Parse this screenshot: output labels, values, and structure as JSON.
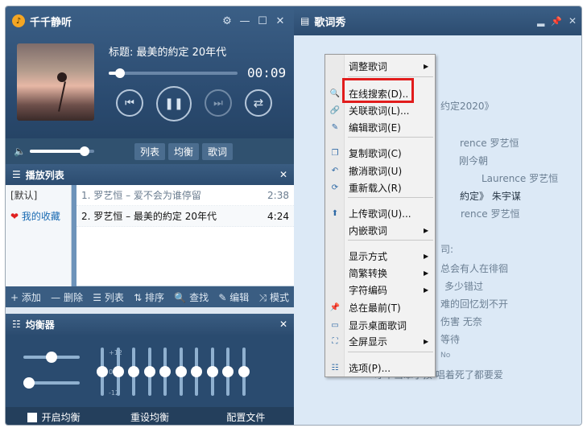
{
  "app": {
    "title": "千千静听",
    "logo_char": "♪"
  },
  "window_controls": {
    "settings": "⚙",
    "minimize": "—",
    "restore": "☐",
    "close": "✕"
  },
  "player": {
    "song_title": "标题: 最美的約定 20年代",
    "time": "00:09",
    "progress_fraction": 0.09,
    "volume_fraction": 0.85,
    "controls": {
      "prev": "⏮",
      "pause": "❚❚",
      "next": "⏭",
      "mode": "⇄"
    },
    "tabs": [
      "列表",
      "均衡",
      "歌词"
    ]
  },
  "playlist": {
    "header": "播放列表",
    "groups": [
      "[默认]",
      "我的收藏"
    ],
    "rows": [
      {
        "name": "1. 罗艺恒 – 爱不会为谁停留",
        "duration": "2:38"
      },
      {
        "name": "2. 罗艺恒 – 最美的約定 20年代",
        "duration": "4:24"
      }
    ],
    "toolbar": [
      "+ 添加",
      "— 删除",
      "☰ 列表",
      "⇅ 排序",
      "🔍 查找",
      "✎ 编辑",
      "⤨ 模式"
    ]
  },
  "equalizer": {
    "header": "均衡器",
    "scale": {
      "top": "+12",
      "mid": "0",
      "bottom": "-12"
    },
    "balance_fraction": 0.5,
    "preamp_fraction": 0.1,
    "bands": [
      0.5,
      0.5,
      0.5,
      0.5,
      0.5,
      0.5,
      0.5,
      0.5,
      0.5,
      0.5
    ],
    "footer": {
      "enable": "开启均衡",
      "reset": "重设均衡",
      "profile": "配置文件"
    }
  },
  "lyrics": {
    "header": "歌词秀",
    "controls": {
      "minimize": "▂",
      "pin": "📌",
      "close": "✕"
    },
    "lines": [
      {
        "text": "约定2020》",
        "cls": ""
      },
      {
        "text": "rence 罗艺恒",
        "cls": ""
      },
      {
        "text": "刚今朝",
        "cls": ""
      },
      {
        "text": "Laurence 罗艺恒",
        "cls": ""
      },
      {
        "text": "約定》 朱宇谋",
        "cls": "dark"
      },
      {
        "text": "rence 罗艺恒",
        "cls": ""
      },
      {
        "text": "司:",
        "cls": ""
      },
      {
        "text": "总会有人在徘徊",
        "cls": ""
      },
      {
        "text": "多少错过",
        "cls": ""
      },
      {
        "text": "难的回忆划不开",
        "cls": ""
      },
      {
        "text": "伤害 无奈",
        "cls": ""
      },
      {
        "text": "等待",
        "cls": ""
      },
      {
        "text": "No",
        "cls": "small"
      },
      {
        "text": "才不当笨小孩 唱着死了都要爱",
        "cls": ""
      }
    ]
  },
  "context_menu": {
    "items": [
      {
        "label": "调整歌词",
        "icon": "",
        "submenu": true
      },
      {
        "label": "在线搜索(D)..",
        "icon": "search",
        "submenu": false
      },
      {
        "label": "关联歌词(L)...",
        "icon": "link",
        "submenu": false
      },
      {
        "label": "编辑歌词(E)",
        "icon": "edit",
        "submenu": false
      },
      {
        "label": "复制歌词(C)",
        "icon": "copy",
        "submenu": false
      },
      {
        "label": "撤消歌词(U)",
        "icon": "undo",
        "submenu": false
      },
      {
        "label": "重新载入(R)",
        "icon": "reload",
        "submenu": false
      },
      {
        "label": "上传歌词(U)...",
        "icon": "upload",
        "submenu": false
      },
      {
        "label": "内嵌歌词",
        "icon": "",
        "submenu": true
      },
      {
        "label": "显示方式",
        "icon": "",
        "submenu": true
      },
      {
        "label": "简繁转换",
        "icon": "",
        "submenu": true
      },
      {
        "label": "字符编码",
        "icon": "",
        "submenu": true
      },
      {
        "label": "总在最前(T)",
        "icon": "pin",
        "submenu": false
      },
      {
        "label": "显示桌面歌词",
        "icon": "desktop",
        "submenu": false
      },
      {
        "label": "全屏显示",
        "icon": "fullscreen",
        "submenu": true
      },
      {
        "label": "选项(P)...",
        "icon": "options",
        "submenu": false
      }
    ],
    "colors": {
      "highlight_border": "#e11c1c"
    }
  }
}
